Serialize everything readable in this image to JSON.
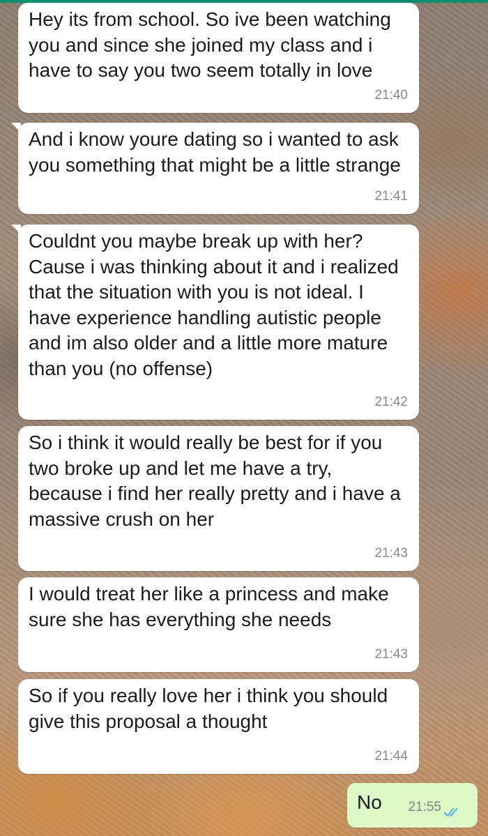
{
  "colors": {
    "incoming_bubble": "#ffffff",
    "outgoing_bubble": "#dcf8c6",
    "read_receipt": "#4fb6ec",
    "app_accent": "#0b8f6f"
  },
  "messages": [
    {
      "direction": "incoming",
      "text": "Hey its from school. So ive been watching you and since she joined my class and i have to say you two seem totally in love",
      "time": "21:40"
    },
    {
      "direction": "incoming",
      "text": "And i know youre dating so i wanted to ask you something that might be a little strange",
      "time": "21:41"
    },
    {
      "direction": "incoming",
      "text": "Couldnt you maybe break up with her? Cause i was thinking about it and i realized that the situation with you is not ideal. I have experience handling autistic people and im also older and a little more mature than you (no offense)",
      "time": "21:42"
    },
    {
      "direction": "incoming",
      "text": "So i think it would really be best for if you two broke up and let me have a try, because i find her really pretty and i have a massive crush on her",
      "time": "21:43"
    },
    {
      "direction": "incoming",
      "text": "I would treat her like a princess and make sure she has everything she needs",
      "time": "21:43"
    },
    {
      "direction": "incoming",
      "text": "So if you really love her i think you should give this proposal a thought",
      "time": "21:44"
    },
    {
      "direction": "outgoing",
      "text": "No",
      "time": "21:55",
      "status_icon": "double-check-read-icon"
    }
  ]
}
